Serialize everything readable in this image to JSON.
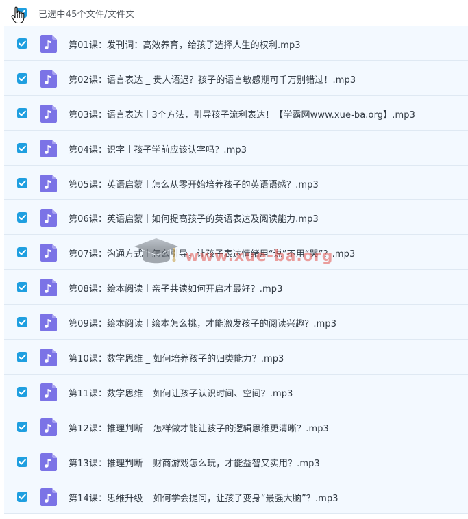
{
  "header": {
    "selection_label": "已选中45个文件/文件夹",
    "checkbox_checked": true
  },
  "watermark": {
    "text": "www.xue-ba.org"
  },
  "files": [
    {
      "name": "第01课：发刊词：高效养育，给孩子选择人生的权利.mp3",
      "checked": true,
      "icon": "audio-file-icon"
    },
    {
      "name": "第02课：语言表达 _ 贵人语迟？孩子的语言敏感期可千万别错过！.mp3",
      "checked": true,
      "icon": "audio-file-icon"
    },
    {
      "name": "第03课：语言表达丨3个方法，引导孩子流利表达！【学霸网www.xue-ba.org】.mp3",
      "checked": true,
      "icon": "audio-file-icon"
    },
    {
      "name": "第04课：识字丨孩子学前应该认字吗？.mp3",
      "checked": true,
      "icon": "audio-file-icon"
    },
    {
      "name": "第05课：英语启蒙丨怎么从零开始培养孩子的英语语感？.mp3",
      "checked": true,
      "icon": "audio-file-icon"
    },
    {
      "name": "第06课：英语启蒙丨如何提高孩子的英语表达及阅读能力.mp3",
      "checked": true,
      "icon": "audio-file-icon"
    },
    {
      "name": "第07课：沟通方式丨怎么引导，让孩子表达情绪用“说”不用“哭”？.mp3",
      "checked": true,
      "icon": "audio-file-icon"
    },
    {
      "name": "第08课：绘本阅读丨亲子共读如何开启才最好？.mp3",
      "checked": true,
      "icon": "audio-file-icon"
    },
    {
      "name": "第09课：绘本阅读丨绘本怎么挑，才能激发孩子的阅读兴趣？.mp3",
      "checked": true,
      "icon": "audio-file-icon"
    },
    {
      "name": "第10课：数学思维 _ 如何培养孩子的归类能力？.mp3",
      "checked": true,
      "icon": "audio-file-icon"
    },
    {
      "name": "第11课：数学思维 _ 如何让孩子认识时间、空间？.mp3",
      "checked": true,
      "icon": "audio-file-icon"
    },
    {
      "name": "第12课：推理判断 _ 怎样做才能让孩子的逻辑思维更清晰？.mp3",
      "checked": true,
      "icon": "audio-file-icon"
    },
    {
      "name": "第13课：推理判断 _ 财商游戏怎么玩，才能益智又实用？.mp3",
      "checked": true,
      "icon": "audio-file-icon"
    },
    {
      "name": "第14课：思维升级 _ 如何学会提问，让孩子变身“最强大脑”？.mp3",
      "checked": true,
      "icon": "audio-file-icon"
    }
  ],
  "colors": {
    "checkbox": "#1f9fe0",
    "row_background": "#f3f9ff",
    "row_divider": "#dfe9f3",
    "file_icon": "#7b73e6",
    "text": "#333b44"
  }
}
